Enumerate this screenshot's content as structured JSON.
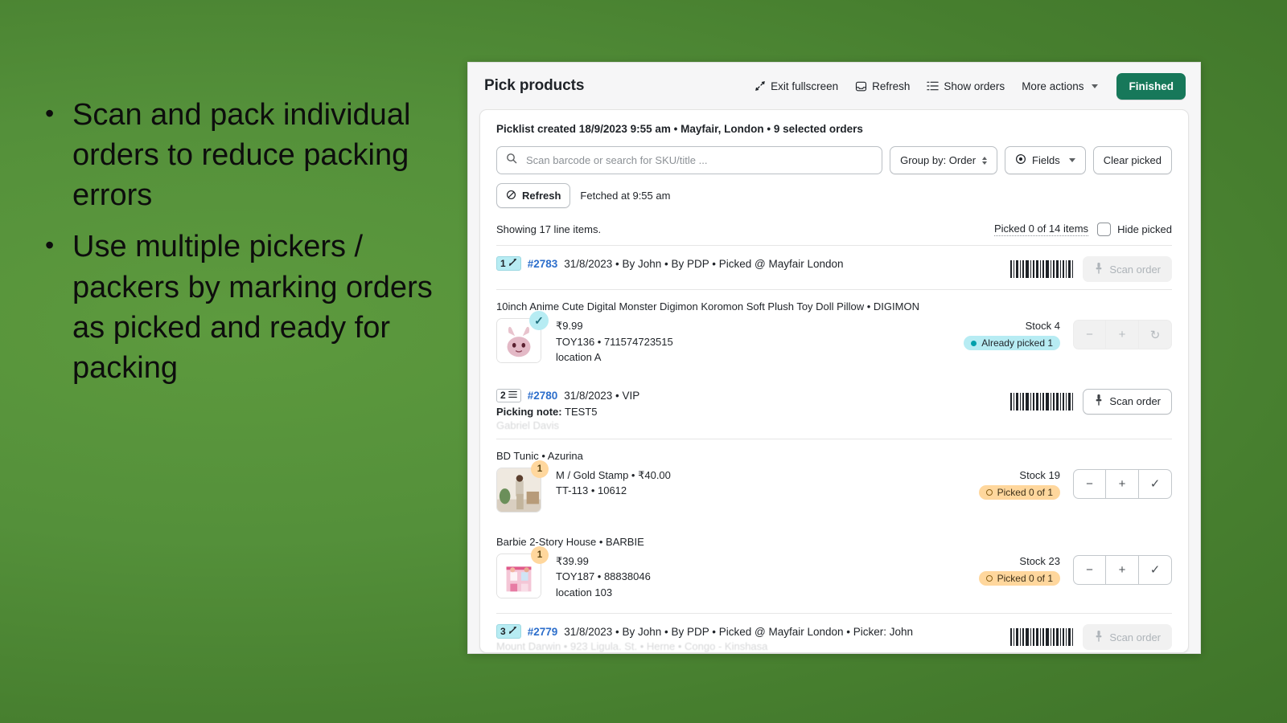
{
  "slide": {
    "bullets": [
      "Scan and pack individual orders to reduce packing errors",
      "Use multiple pickers / packers by marking orders as picked and ready for packing"
    ],
    "bullet_glyph": "•",
    "background_color": "#4e8a33"
  },
  "app": {
    "title": "Pick products",
    "header_actions": [
      {
        "label": "Exit fullscreen",
        "icon": "exit-fullscreen-icon"
      },
      {
        "label": "Refresh",
        "icon": "refresh-inbox-icon"
      },
      {
        "label": "Show orders",
        "icon": "list-icon"
      },
      {
        "label": "More actions",
        "icon": "chevron-down-icon"
      }
    ],
    "primary_button": "Finished",
    "primary_color": "#17785a"
  },
  "picklist": {
    "meta": "Picklist created 18/9/2023 9:55 am • Mayfair, London • 9 selected orders",
    "search_placeholder": "Scan barcode or search for SKU/title ...",
    "search_value": "",
    "group_by_label": "Group by: Order",
    "fields_label": "Fields",
    "clear_picked_label": "Clear picked",
    "refresh_label": "Refresh",
    "fetched_text": "Fetched at 9:55 am",
    "showing_text": "Showing 17 line items.",
    "picked_count": "Picked 0 of 14 items",
    "hide_picked_label": "Hide picked"
  },
  "orders": [
    {
      "seq": "1",
      "seq_icon": "pencil-icon",
      "seq_style": "cyan",
      "number": "#2783",
      "meta": "31/8/2023 • By John • By PDP • Picked @ Mayfair London",
      "scan_label": "Scan order",
      "scan_disabled": true,
      "picking_note": null,
      "customer": null,
      "lines": [
        {
          "title": "10inch Anime Cute Digital Monster Digimon Koromon Soft Plush Toy Doll Pillow • DIGIMON",
          "price": "₹9.99",
          "sku": "TOY136 • 711574723515",
          "location": "location A",
          "stock": "Stock 4",
          "pill": "Already picked 1",
          "pill_style": "cyan",
          "badge": "✓",
          "badge_style": "check",
          "thumb": "plush-toy-thumbnail",
          "stepper_disabled": true,
          "stepper_last": "↻"
        }
      ]
    },
    {
      "seq": "2",
      "seq_icon": "list-icon",
      "seq_style": "plain",
      "number": "#2780",
      "meta": "31/8/2023 • VIP",
      "scan_label": "Scan order",
      "scan_disabled": false,
      "picking_note_label": "Picking note:",
      "picking_note": "TEST5",
      "customer": "Gabriel Davis",
      "lines": [
        {
          "title": "BD Tunic • Azurina",
          "price": "M / Gold Stamp • ₹40.00",
          "sku": "TT-113 • 10612",
          "location": "",
          "stock": "Stock 19",
          "pill": "Picked 0 of 1",
          "pill_style": "amber",
          "badge": "1",
          "badge_style": "qty",
          "thumb": "tunic-model-thumbnail",
          "stepper_disabled": false,
          "stepper_last": "✓"
        },
        {
          "title": "Barbie 2-Story House • BARBIE",
          "price": "₹39.99",
          "sku": "TOY187 • 88838046",
          "location": "location 103",
          "stock": "Stock 23",
          "pill": "Picked 0 of 1",
          "pill_style": "amber",
          "badge": "1",
          "badge_style": "qty",
          "thumb": "barbie-house-thumbnail",
          "stepper_disabled": false,
          "stepper_last": "✓"
        }
      ]
    },
    {
      "seq": "3",
      "seq_icon": "pencil-icon",
      "seq_style": "cyan",
      "number": "#2779",
      "meta": "31/8/2023 • By John • By PDP • Picked @ Mayfair London • Picker: John",
      "scan_label": "Scan order",
      "scan_disabled": true,
      "address": "Mount Darwin • 923 Ligula. St. • Herne • Congo - Kinshasa",
      "lines": []
    }
  ],
  "stepper": {
    "minus": "−",
    "plus": "+"
  }
}
